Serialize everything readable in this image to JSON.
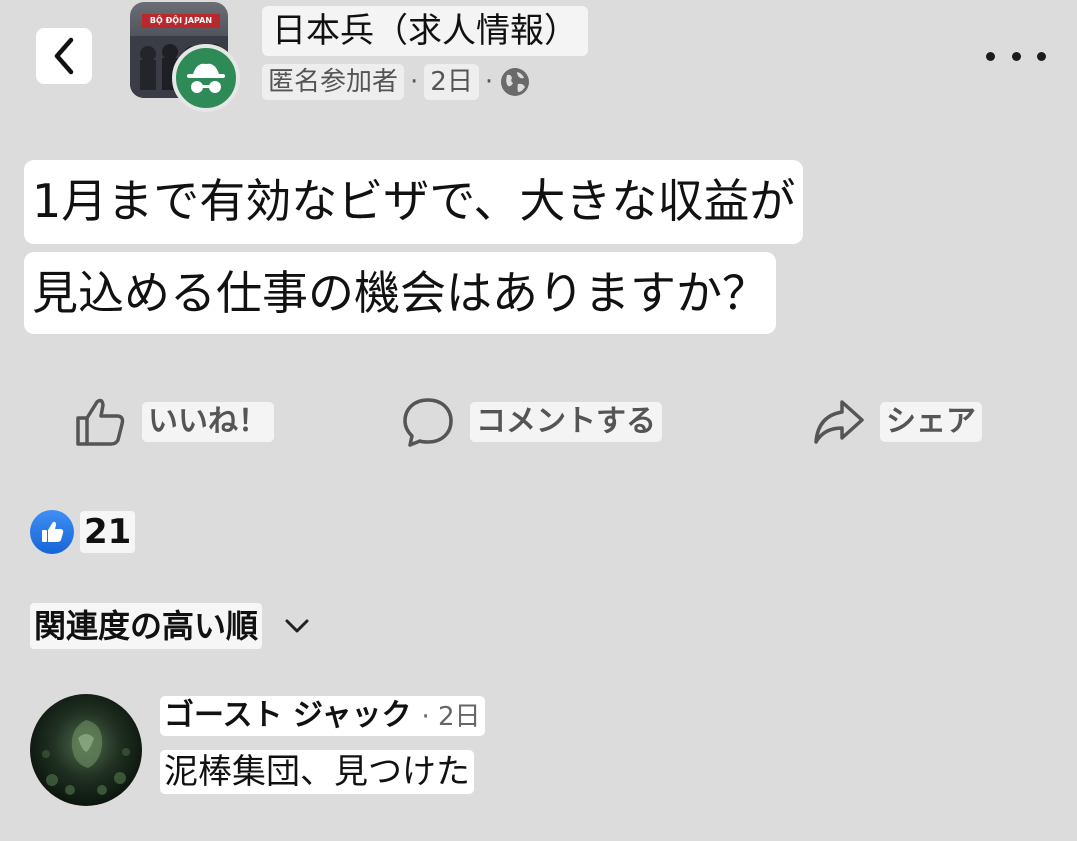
{
  "header": {
    "group_name": "日本兵（求人情報）",
    "group_thumbnail_sign": "BỘ ĐỘI JAPAN",
    "author": "匿名参加者",
    "separator": "·",
    "time": "2日",
    "privacy_icon": "globe-icon",
    "back_icon": "chevron-left-icon",
    "more_icon": "more-dots-icon",
    "anon_avatar_color": "#2e8b57"
  },
  "post": {
    "line1": "1月まで有効なビザで、大きな収益が",
    "line2": "見込める仕事の機会はありますか？"
  },
  "actions": {
    "like": "いいね！",
    "comment": "コメントする",
    "share": "シェア"
  },
  "reactions": {
    "count": "21",
    "icon": "like-thumb-icon",
    "badge_color": "#1877f2"
  },
  "comments": {
    "sort_label": "関連度の高い順",
    "items": [
      {
        "author": "ゴースト ジャック",
        "time": "· 2日",
        "text": "泥棒集団、見つけた"
      }
    ]
  }
}
